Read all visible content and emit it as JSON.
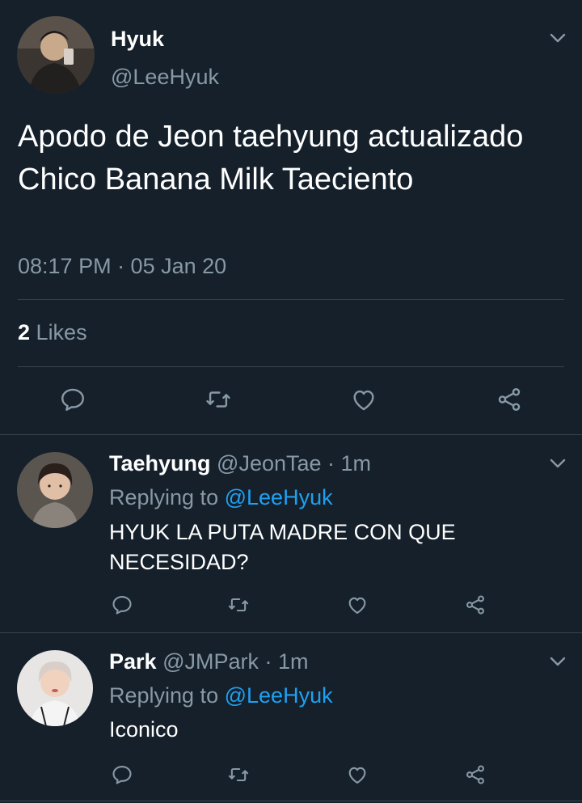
{
  "tweet": {
    "name": "Hyuk",
    "handle": "@LeeHyuk",
    "text": "Apodo de Jeon taehyung actualizado Chico Banana Milk Taeciento",
    "time": "08:17 PM · 05 Jan 20",
    "likes_count": "2",
    "likes_label": "Likes"
  },
  "replies": [
    {
      "name": "Taehyung",
      "handle": "@JeonTae",
      "time": "· 1m",
      "replying_label": "Replying to",
      "replying_to": "@LeeHyuk",
      "text": "HYUK LA PUTA MADRE CON QUE NECESIDAD?"
    },
    {
      "name": "Park",
      "handle": "@JMPark",
      "time": "· 1m",
      "replying_label": "Replying to",
      "replying_to": "@LeeHyuk",
      "text": "Iconico"
    }
  ],
  "icons": {
    "reply": "reply-icon",
    "retweet": "retweet-icon",
    "like": "heart-icon",
    "share": "share-icon",
    "more": "chevron-down-icon"
  },
  "colors": {
    "background": "#15202b",
    "muted": "#8899a6",
    "link": "#1da1f2",
    "divider": "#38444d"
  }
}
